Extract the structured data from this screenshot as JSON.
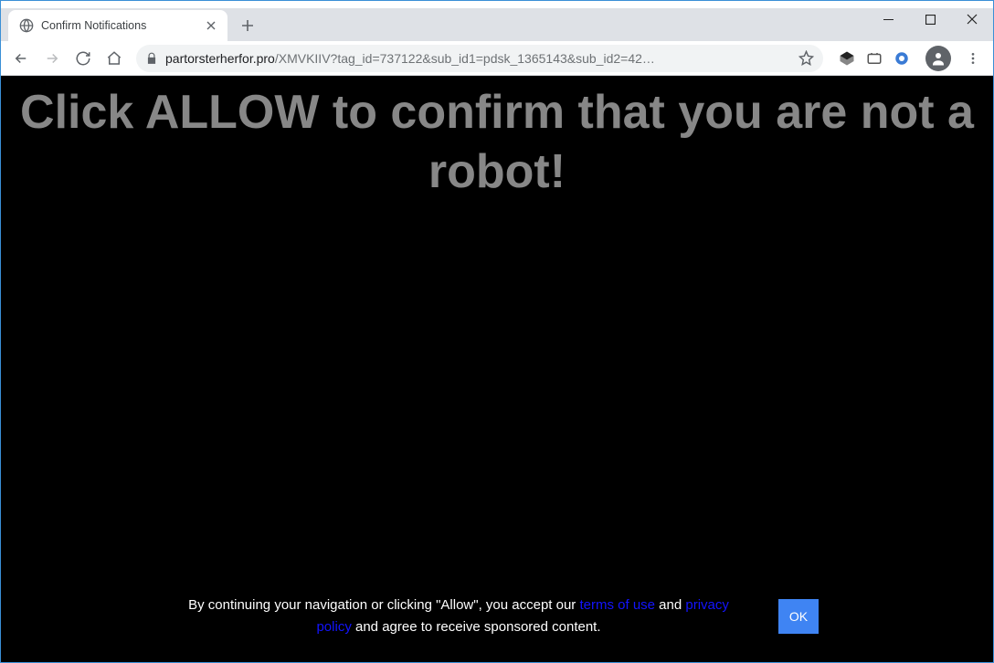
{
  "window": {
    "tab_title": "Confirm Notifications"
  },
  "toolbar": {
    "url_domain": "partorsterherfor.pro",
    "url_path": "/XMVKIIV?tag_id=737122&sub_id1=pdsk_1365143&sub_id2=42…"
  },
  "page": {
    "headline": "Click ALLOW to confirm that you are not a robot!",
    "consent_prefix": "By continuing your navigation or clicking \"Allow\", you accept our ",
    "terms_link": "terms of use",
    "consent_mid": " and ",
    "privacy_link": "privacy policy",
    "consent_suffix": " and agree to receive sponsored content.",
    "ok_label": "OK"
  }
}
